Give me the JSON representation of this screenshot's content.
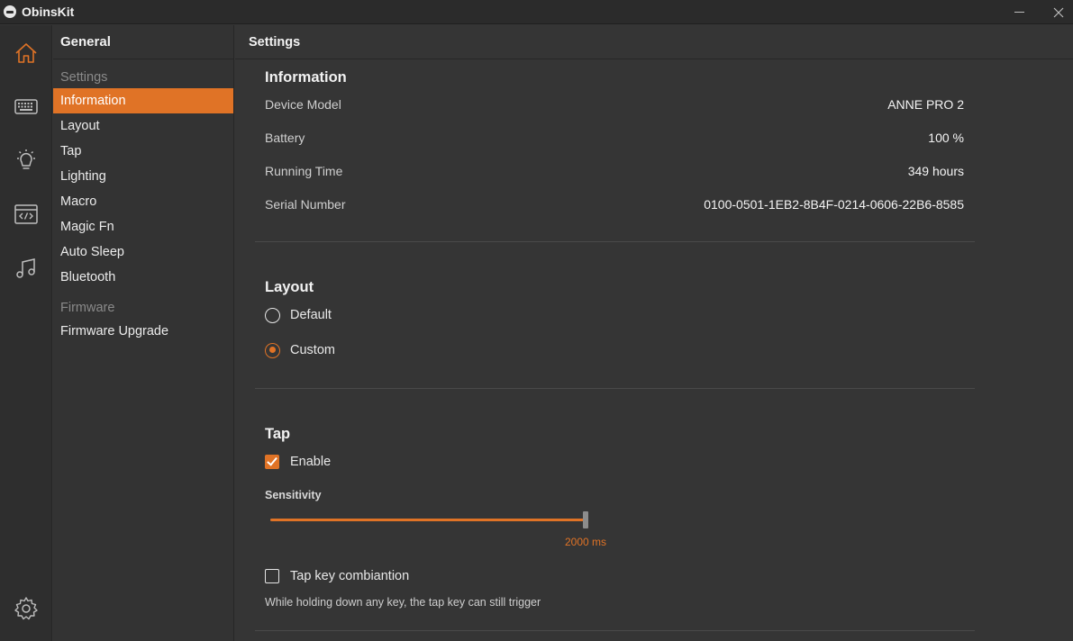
{
  "window": {
    "title": "ObinsKit",
    "minimize_icon": "minimize-icon",
    "close_icon": "close-icon"
  },
  "rail": {
    "accent": "#e07326",
    "items": [
      {
        "icon": "home-icon",
        "active": true
      },
      {
        "icon": "keyboard-icon",
        "active": false
      },
      {
        "icon": "lightbulb-icon",
        "active": false
      },
      {
        "icon": "code-icon",
        "active": false
      },
      {
        "icon": "music-icon",
        "active": false
      },
      {
        "icon": "gear-icon",
        "active": false
      }
    ]
  },
  "nav": {
    "title": "General",
    "groups": [
      {
        "label": "Settings",
        "items": [
          "Information",
          "Layout",
          "Tap",
          "Lighting",
          "Macro",
          "Magic Fn",
          "Auto Sleep",
          "Bluetooth"
        ]
      },
      {
        "label": "Firmware",
        "items": [
          "Firmware Upgrade"
        ]
      }
    ],
    "active_item": "Information"
  },
  "main": {
    "title": "Settings",
    "information": {
      "title": "Information",
      "rows": [
        {
          "label": "Device Model",
          "value": "ANNE PRO 2"
        },
        {
          "label": "Battery",
          "value": "100 %"
        },
        {
          "label": "Running Time",
          "value": "349 hours"
        },
        {
          "label": "Serial Number",
          "value": "0100-0501-1EB2-8B4F-0214-0606-22B6-8585"
        }
      ]
    },
    "layout": {
      "title": "Layout",
      "options": [
        {
          "label": "Default",
          "checked": false
        },
        {
          "label": "Custom",
          "checked": true
        }
      ]
    },
    "tap": {
      "title": "Tap",
      "enable_label": "Enable",
      "enable_checked": true,
      "sensitivity_label": "Sensitivity",
      "sensitivity_value": "2000 ms",
      "sensitivity_fraction": 1.0,
      "combination_label": "Tap key combiantion",
      "combination_checked": false,
      "combination_hint": "While holding down any key, the tap key can still trigger"
    }
  }
}
